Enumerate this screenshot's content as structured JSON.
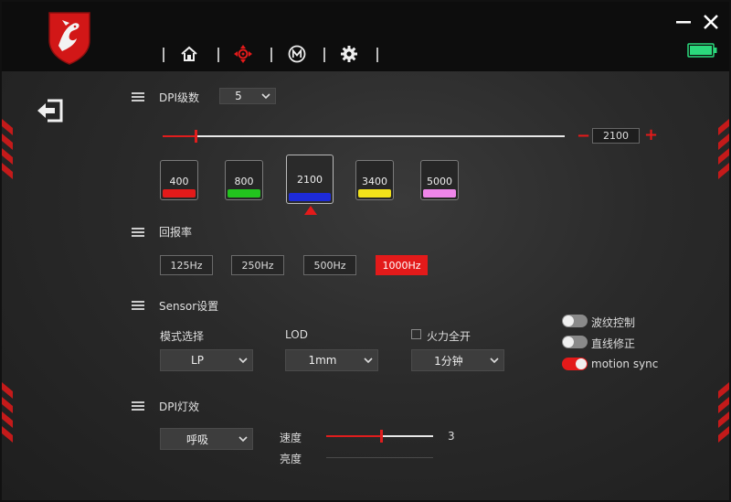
{
  "header": {
    "nav": [
      {
        "name": "home-icon"
      },
      {
        "name": "dpi-icon",
        "active": true
      },
      {
        "name": "macro-icon"
      },
      {
        "name": "settings-icon"
      }
    ],
    "minimize_icon": "minimize-icon",
    "close_icon": "close-icon",
    "battery_level": 1.0
  },
  "colors": {
    "accent": "#e31a1a",
    "battery": "#2bd97c"
  },
  "dpi": {
    "title": "DPI级数",
    "levels_count": "5",
    "slider_fraction": 0.08,
    "value": "2100",
    "minus": "−",
    "plus": "+",
    "levels": [
      {
        "value": "400",
        "color": "#e31a1a"
      },
      {
        "value": "800",
        "color": "#22c41e"
      },
      {
        "value": "2100",
        "color": "#1d2bd9",
        "active": true
      },
      {
        "value": "3400",
        "color": "#f2e21a"
      },
      {
        "value": "5000",
        "color": "#ef86ea"
      }
    ]
  },
  "report_rate": {
    "title": "回报率",
    "options": [
      "125Hz",
      "250Hz",
      "500Hz",
      "1000Hz"
    ],
    "selected": "1000Hz"
  },
  "sensor": {
    "title": "Sensor设置",
    "mode_label": "模式选择",
    "mode_value": "LP",
    "lod_label": "LOD",
    "lod_value": "1mm",
    "fire_label": "火力全开",
    "fire_checked": false,
    "fire_value": "1分钟",
    "toggles": [
      {
        "label": "波纹控制",
        "on": false
      },
      {
        "label": "直线修正",
        "on": false
      },
      {
        "label": "motion sync",
        "on": true
      }
    ]
  },
  "light": {
    "title": "DPI灯效",
    "effect_value": "呼吸",
    "speed_label": "速度",
    "speed_value": "3",
    "speed_fraction": 0.5,
    "brightness_label": "亮度",
    "brightness_fraction": 0.0
  }
}
